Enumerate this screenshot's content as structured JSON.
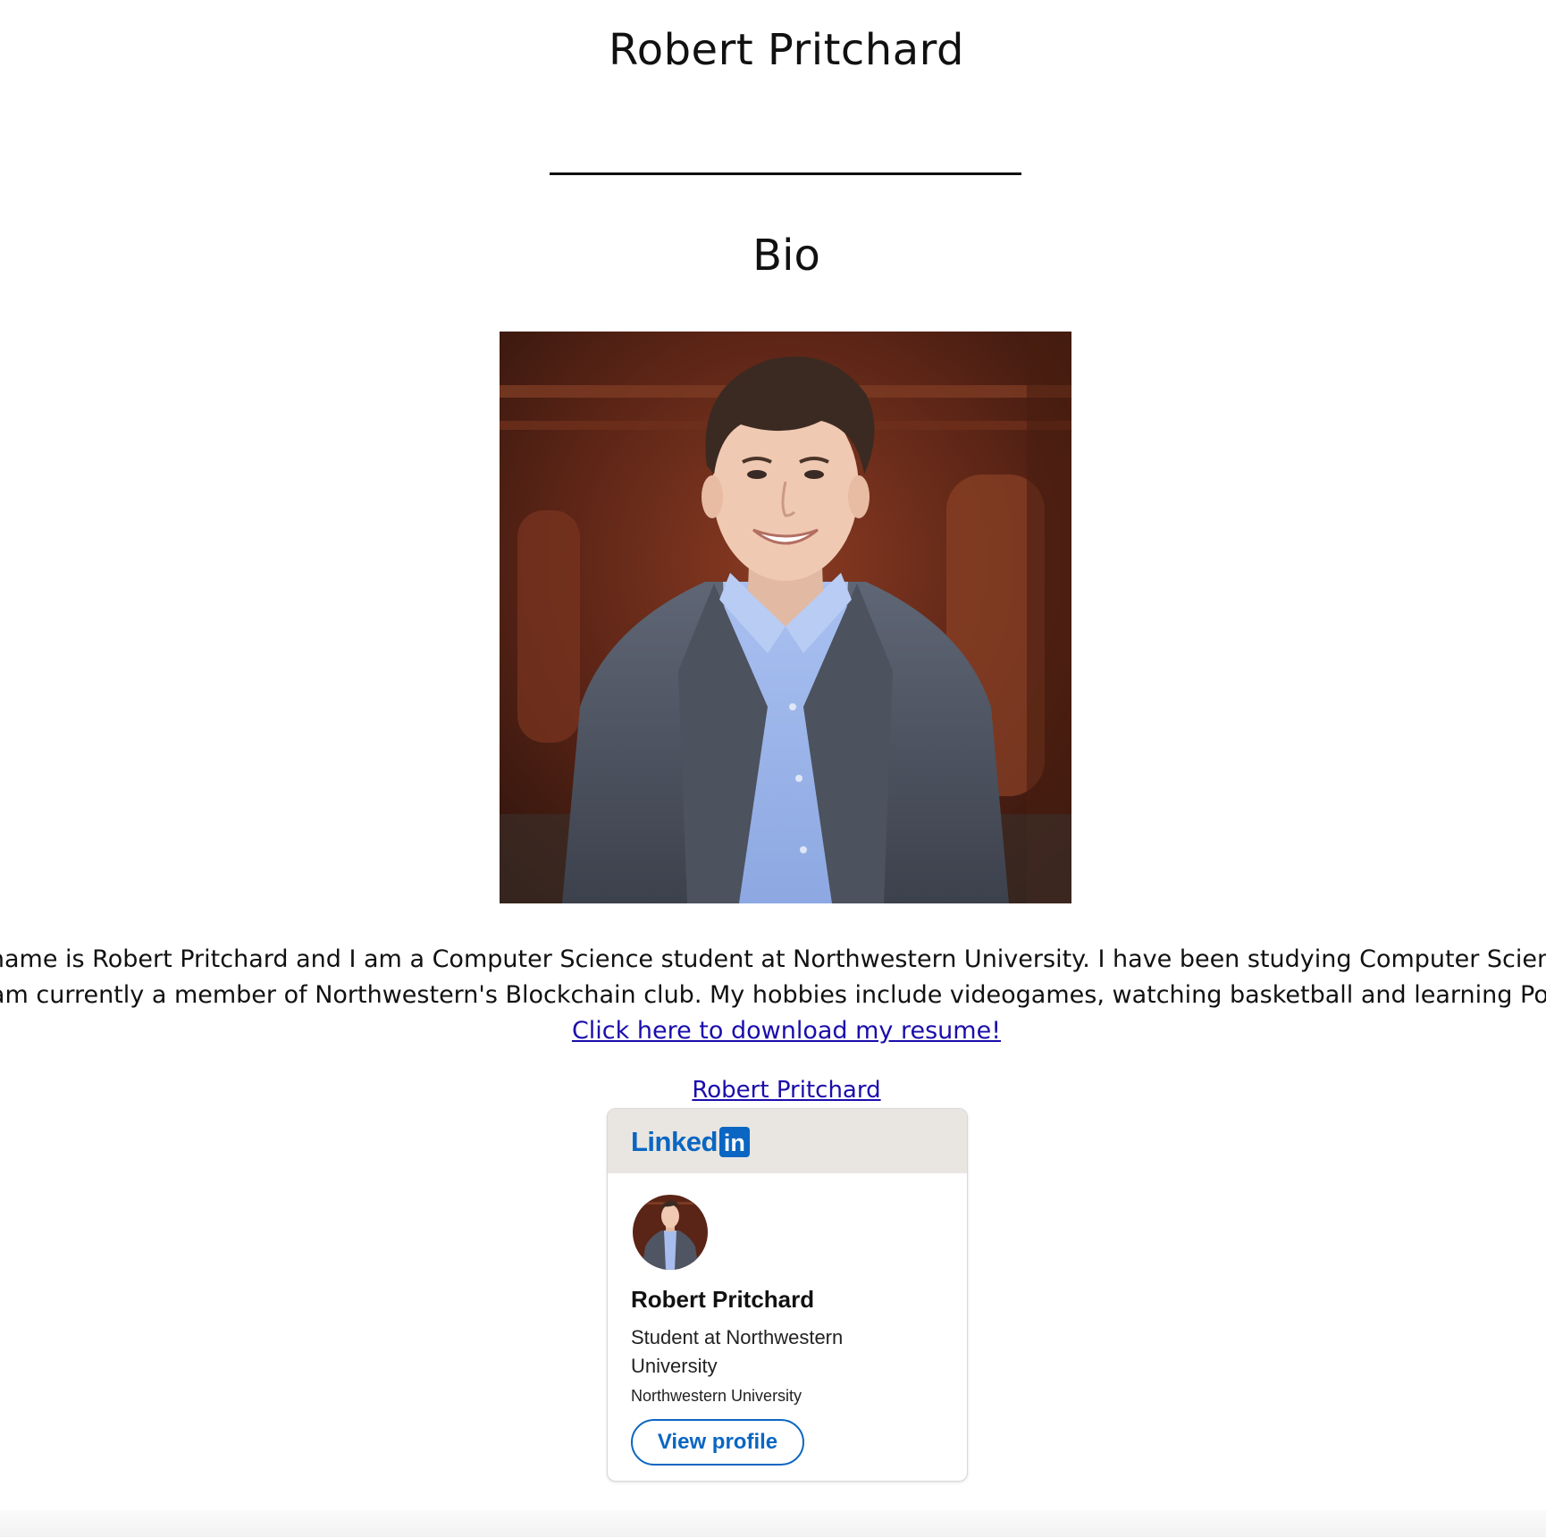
{
  "header": {
    "site_title": "Robert Pritchard"
  },
  "bio_section": {
    "heading": "Bio",
    "portrait_alt": "portrait photo",
    "text_line_1": "My name is Robert Pritchard and I am a Computer Science student at Northwestern University. I have been studying Computer Science and programming since",
    "text_line_2": "I am currently a member of Northwestern's Blockchain club. My hobbies include videogames, watching basketball and learning Polish.",
    "resume_link": "Click here to download my resume!"
  },
  "linkedin_badge": {
    "name_link": "Robert Pritchard",
    "logo_word": "Linked",
    "logo_box": "in",
    "person_name": "Robert Pritchard",
    "headline": "Student at Northwestern University",
    "school": "Northwestern University",
    "view_profile_label": "View profile",
    "brand_color": "#0a66c2"
  }
}
